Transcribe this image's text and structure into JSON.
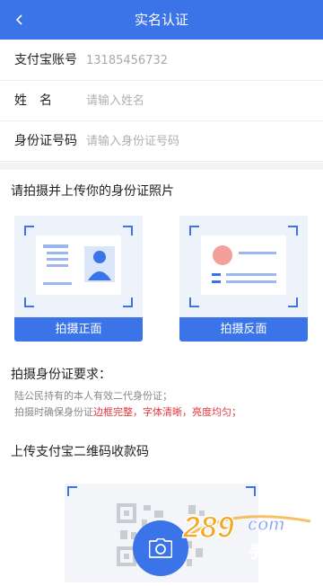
{
  "header": {
    "title": "实名认证"
  },
  "form": {
    "alipay_label": "支付宝账号",
    "alipay_value": "13185456732",
    "name_label": "姓　名",
    "name_placeholder": "请输入姓名",
    "id_label": "身份证号码",
    "id_placeholder": "请输入身份证号码"
  },
  "upload": {
    "title": "请拍摄并上传你的身份证照片",
    "front_button": "拍摄正面",
    "back_button": "拍摄反面"
  },
  "requirements": {
    "title": "拍摄身份证要求：",
    "line1": "陆公民持有的本人有效二代身份证；",
    "line2_prefix": "拍摄时确保身份证",
    "line2_highlight": "边框完整，字体清晰，亮度均匀；"
  },
  "qrcode": {
    "title": "上传支付宝二维码收款码"
  },
  "watermark": {
    "brand": "289",
    "site": "com",
    "sub": "手游网"
  },
  "colors": {
    "primary": "#3b73e9",
    "highlight": "#e0373b",
    "card_bg": "#eef2fb"
  }
}
